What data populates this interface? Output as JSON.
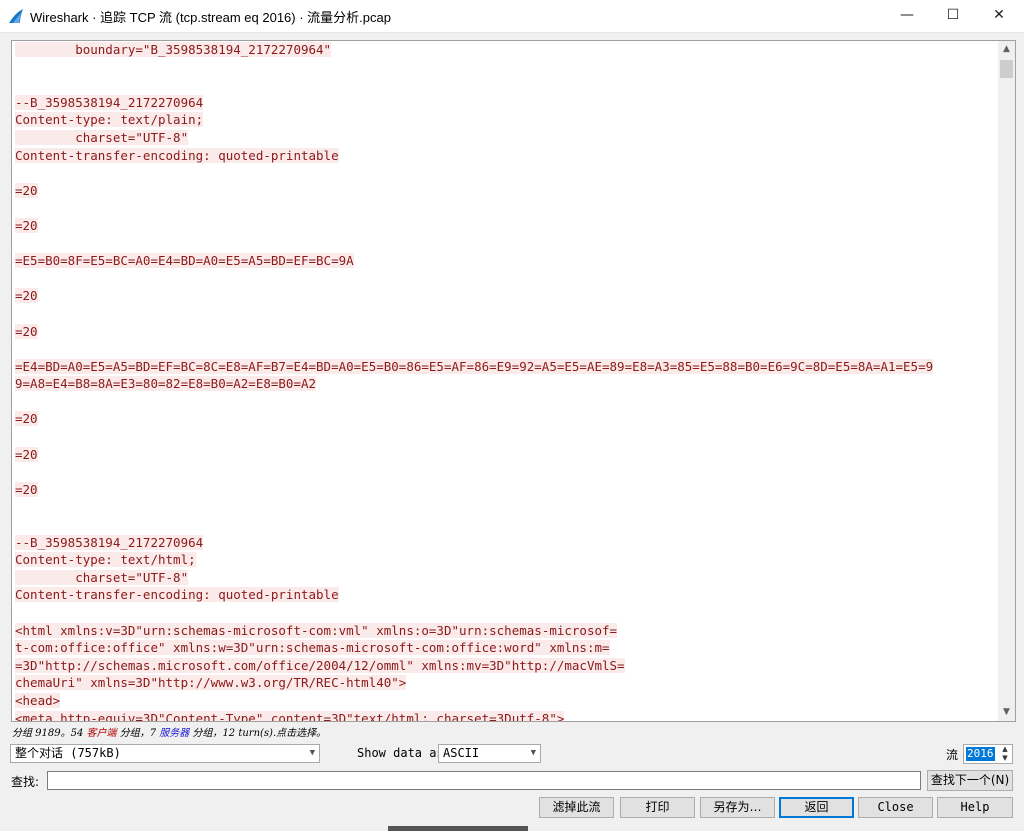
{
  "window": {
    "title": "Wireshark · 追踪 TCP 流 (tcp.stream eq 2016) · 流量分析.pcap",
    "minimize_glyph": "—",
    "maximize_glyph": "☐",
    "close_glyph": "✕"
  },
  "icons": {
    "app": "wireshark-fin-icon",
    "scroll_up": "chevron-up-icon",
    "scroll_down": "chevron-down-icon",
    "dropdown": "chevron-down-icon"
  },
  "colors": {
    "client_text": "#8b1a1a",
    "client_bg": "#fbeaea",
    "selection": "#0078d7",
    "accent_border": "#0078d7"
  },
  "stream": {
    "lines": [
      "        boundary=\"B_3598538194_2172270964\"",
      "",
      "",
      "--B_3598538194_2172270964",
      "Content-type: text/plain;",
      "        charset=\"UTF-8\"",
      "Content-transfer-encoding: quoted-printable",
      "",
      "=20",
      "",
      "=20",
      "",
      "=E5=B0=8F=E5=BC=A0=E4=BD=A0=E5=A5=BD=EF=BC=9A",
      "",
      "=20",
      "",
      "=20",
      "",
      "=E4=BD=A0=E5=A5=BD=EF=BC=8C=E8=AF=B7=E4=BD=A0=E5=B0=86=E5=AF=86=E9=92=A5=E5=AE=89=E8=A3=85=E5=88=B0=E6=9C=8D=E5=8A=A1=E5=9",
      "9=A8=E4=B8=8A=E3=80=82=E8=B0=A2=E8=B0=A2",
      "",
      "=20",
      "",
      "=20",
      "",
      "=20",
      "",
      "",
      "--B_3598538194_2172270964",
      "Content-type: text/html;",
      "        charset=\"UTF-8\"",
      "Content-transfer-encoding: quoted-printable",
      "",
      "<html xmlns:v=3D\"urn:schemas-microsoft-com:vml\" xmlns:o=3D\"urn:schemas-microsof=",
      "t-com:office:office\" xmlns:w=3D\"urn:schemas-microsoft-com:office:word\" xmlns:m=",
      "=3D\"http://schemas.microsoft.com/office/2004/12/omml\" xmlns:mv=3D\"http://macVmlS=",
      "chemaUri\" xmlns=3D\"http://www.w3.org/TR/REC-html40\">",
      "<head>",
      "<meta http-equiv=3D\"Content-Type\" content=3D\"text/html; charset=3Dutf-8\">"
    ],
    "scroll_fraction": 0.0
  },
  "status": {
    "part1": "分组 9189。54 ",
    "client": "客户端",
    "part2": " 分组，7 ",
    "server": "服务器",
    "part3": " 分组，12 turn(s).点击选择。"
  },
  "controls": {
    "conversation_select": "整个对话 (757kB)",
    "show_data_label": "Show data as",
    "format_select": "ASCII",
    "stream_label": "流",
    "stream_number": "2016",
    "find_label": "查找:",
    "find_value": "",
    "find_next_button": "查找下一个(N)"
  },
  "buttons": {
    "filter_out": "滤掉此流",
    "print": "打印",
    "save_as": "另存为…",
    "back": "返回",
    "close": "Close",
    "help": "Help"
  }
}
